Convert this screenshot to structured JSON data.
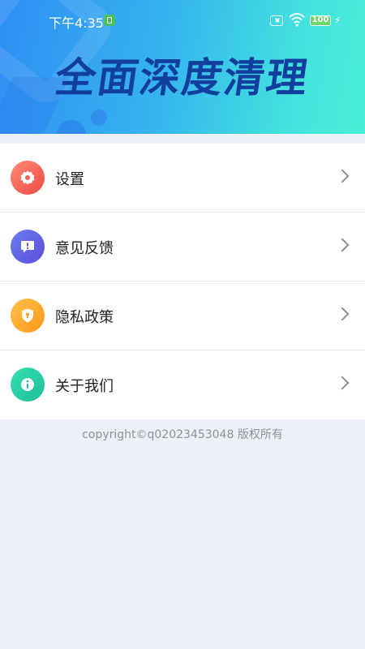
{
  "status_bar": {
    "time": "下午4:35",
    "battery": "100"
  },
  "header": {
    "title": "全面深度清理"
  },
  "menu": {
    "items": [
      {
        "label": "设置",
        "icon": "gear-icon",
        "color": "#ee4a45"
      },
      {
        "label": "意见反馈",
        "icon": "feedback-bubble-icon",
        "color": "#5a4fd8"
      },
      {
        "label": "隐私政策",
        "icon": "privacy-shield-icon",
        "color": "#ff9618"
      },
      {
        "label": "关于我们",
        "icon": "info-icon",
        "color": "#1bbd97"
      }
    ]
  },
  "footer": {
    "copyright": "copyright©q02023453048 版权所有"
  }
}
